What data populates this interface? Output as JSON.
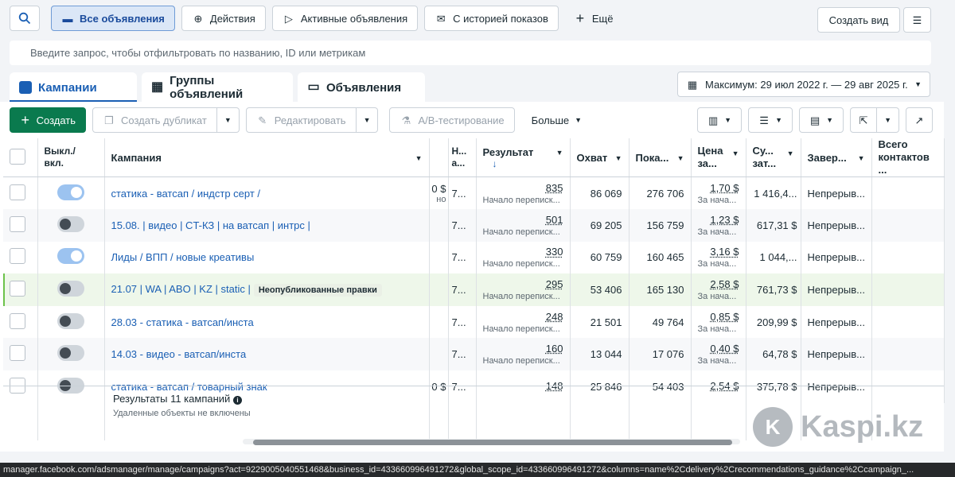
{
  "topbar": {
    "all_ads": "Все объявления",
    "actions": "Действия",
    "active_ads": "Активные объявления",
    "with_history": "С историей показов",
    "more": "Ещё",
    "create_view": "Создать вид"
  },
  "filter": {
    "placeholder": "Введите запрос, чтобы отфильтровать по названию, ID или метрикам"
  },
  "tabs": [
    {
      "label": "Кампании"
    },
    {
      "label": "Группы объявлений"
    },
    {
      "label": "Объявления"
    }
  ],
  "date_range": "Максимум: 29 июл 2022 г. — 29 авг 2025 г.",
  "toolbar": {
    "create": "Создать",
    "duplicate": "Создать дубликат",
    "edit": "Редактировать",
    "ab_test": "A/B-тестирование",
    "more": "Больше"
  },
  "table": {
    "headers": {
      "toggle": "Выкл./ вкл.",
      "campaign": "Кампания",
      "delivery": "Н... а...",
      "result": "Результат",
      "reach": "Охват",
      "impressions": "Пока...",
      "price": "Цена за...",
      "spent": "Су... зат...",
      "end": "Завер...",
      "contacts": "Всего контактов ..."
    },
    "rows": [
      {
        "on": true,
        "name": "статика - ватсап / индстр серт /",
        "partial": "0 $",
        "partial_sub": "но",
        "delivery": "7...",
        "result": "835",
        "result_sub": "Начало переписк...",
        "reach": "86 069",
        "impressions": "276 706",
        "price": "1,70 $",
        "price_sub": "За нача...",
        "spent": "1 416,4...",
        "end": "Непрерыв...",
        "badge": ""
      },
      {
        "on": false,
        "name": "15.08. | видео | CT-КЗ | на ватсап | интрс |",
        "partial": "",
        "partial_sub": "",
        "delivery": "7...",
        "result": "501",
        "result_sub": "Начало переписк...",
        "reach": "69 205",
        "impressions": "156 759",
        "price": "1,23 $",
        "price_sub": "За нача...",
        "spent": "617,31 $",
        "end": "Непрерыв...",
        "badge": ""
      },
      {
        "on": true,
        "name": "Лиды / ВПП / новые креативы",
        "partial": "",
        "partial_sub": "",
        "delivery": "7...",
        "result": "330",
        "result_sub": "Начало переписк...",
        "reach": "60 759",
        "impressions": "160 465",
        "price": "3,16 $",
        "price_sub": "За нача...",
        "spent": "1 044,...",
        "end": "Непрерыв...",
        "badge": ""
      },
      {
        "on": false,
        "name": "21.07 | WA | ABO | KZ | static |",
        "partial": "",
        "partial_sub": "",
        "delivery": "7...",
        "result": "295",
        "result_sub": "Начало переписк...",
        "reach": "53 406",
        "impressions": "165 130",
        "price": "2,58 $",
        "price_sub": "За нача...",
        "spent": "761,73 $",
        "end": "Непрерыв...",
        "badge": "Неопубликованные правки"
      },
      {
        "on": false,
        "name": "28.03 - статика - ватсап/инста",
        "partial": "",
        "partial_sub": "",
        "delivery": "7...",
        "result": "248",
        "result_sub": "Начало переписк...",
        "reach": "21 501",
        "impressions": "49 764",
        "price": "0,85 $",
        "price_sub": "За нача...",
        "spent": "209,99 $",
        "end": "Непрерыв...",
        "badge": ""
      },
      {
        "on": false,
        "name": "14.03 - видео - ватсап/инста",
        "partial": "",
        "partial_sub": "",
        "delivery": "7...",
        "result": "160",
        "result_sub": "Начало переписк...",
        "reach": "13 044",
        "impressions": "17 076",
        "price": "0,40 $",
        "price_sub": "За нача...",
        "spent": "64,78 $",
        "end": "Непрерыв...",
        "badge": ""
      },
      {
        "on": false,
        "name": "статика - ватсап / товарный знак",
        "partial": "0 $",
        "partial_sub": "",
        "delivery": "7...",
        "result": "148",
        "result_sub": "",
        "reach": "25 846",
        "impressions": "54 403",
        "price": "2,54 $",
        "price_sub": "",
        "spent": "375,78 $",
        "end": "Непрерыв...",
        "badge": ""
      }
    ]
  },
  "footer": {
    "results": "Результаты 11 кампаний",
    "deleted": "Удаленные объекты не включены"
  },
  "url": "manager.facebook.com/adsmanager/manage/campaigns?act=9229005040551468&business_id=433660996491272&global_scope_id=433660996491272&columns=name%2Cdelivery%2Crecommendations_guidance%2Ccampaign_...",
  "watermark": "Kaspi.kz"
}
